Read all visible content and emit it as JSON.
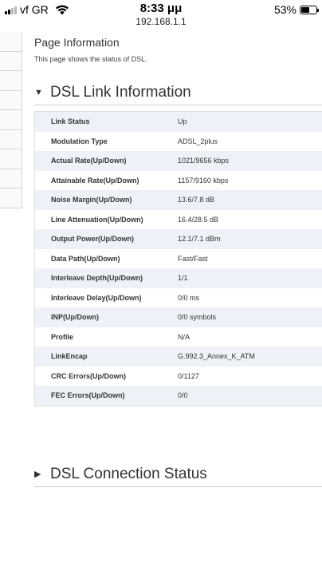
{
  "status_bar": {
    "carrier": "vf GR",
    "time": "8:33 μμ",
    "url": "192.168.1.1",
    "battery_percent": "53%",
    "battery_level": 0.53,
    "signal_bars": 2
  },
  "page": {
    "title": "Page Information",
    "description": "This page shows the status of DSL."
  },
  "sections": {
    "link_info": {
      "title": "DSL Link Information",
      "state": "expanded",
      "triangle": "▼"
    },
    "conn_status": {
      "title": "DSL Connection Status",
      "state": "collapsed",
      "triangle": "▶"
    }
  },
  "link_table": [
    {
      "label": "Link Status",
      "value": "Up"
    },
    {
      "label": "Modulation Type",
      "value": "ADSL_2plus"
    },
    {
      "label": "Actual Rate(Up/Down)",
      "value": "1021/9656 kbps"
    },
    {
      "label": "Attainable Rate(Up/Down)",
      "value": "1157/9160 kbps"
    },
    {
      "label": "Noise Margin(Up/Down)",
      "value": "13.6/7.8 dB"
    },
    {
      "label": "Line Attenuation(Up/Down)",
      "value": "16.4/28.5 dB"
    },
    {
      "label": "Output Power(Up/Down)",
      "value": "12.1/7.1 dBm"
    },
    {
      "label": "Data Path(Up/Down)",
      "value": "Fast/Fast"
    },
    {
      "label": "Interleave Depth(Up/Down)",
      "value": "1/1"
    },
    {
      "label": "Interleave Delay(Up/Down)",
      "value": "0/0 ms"
    },
    {
      "label": "INP(Up/Down)",
      "value": "0/0 symbols"
    },
    {
      "label": "Profile",
      "value": "N/A"
    },
    {
      "label": "LinkEncap",
      "value": "G.992.3_Annex_K_ATM"
    },
    {
      "label": "CRC Errors(Up/Down)",
      "value": "0/1127"
    },
    {
      "label": "FEC Errors(Up/Down)",
      "value": "0/0"
    }
  ],
  "icons": {
    "signal": "signal-bars-icon",
    "wifi": "wifi-icon",
    "battery": "battery-icon"
  }
}
